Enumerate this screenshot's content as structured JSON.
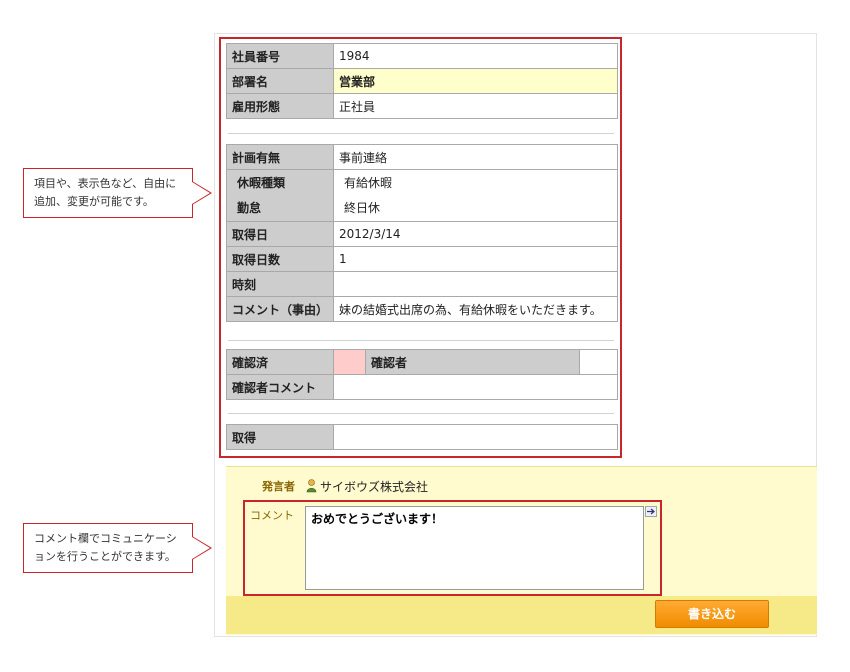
{
  "form": {
    "employee_no": {
      "label": "社員番号",
      "value": "1984"
    },
    "department": {
      "label": "部署名",
      "value": "営業部"
    },
    "employment_type": {
      "label": "雇用形態",
      "value": "正社員"
    },
    "plan": {
      "label": "計画有無",
      "value": "事前連絡"
    },
    "leave_type": {
      "label": "休暇種類",
      "value": "有給休暇"
    },
    "attendance": {
      "label": "勤怠",
      "value": "終日休"
    },
    "date": {
      "label": "取得日",
      "value": "2012/3/14"
    },
    "days": {
      "label": "取得日数",
      "value": "1"
    },
    "time": {
      "label": "時刻",
      "value": ""
    },
    "comment_reason": {
      "label": "コメント（事由）",
      "value": "妹の結婚式出席の為、有給休暇をいただきます。"
    },
    "confirmed": {
      "label": "確認済",
      "value": ""
    },
    "confirmer": {
      "label": "確認者",
      "value": ""
    },
    "confirmer_comment": {
      "label": "確認者コメント",
      "value": ""
    },
    "acquired": {
      "label": "取得",
      "value": ""
    }
  },
  "callouts": {
    "items_note": "項目や、表示色など、自由に追加、変更が可能です。",
    "comment_note": "コメント欄でコミュニケーションを行うことができます。"
  },
  "comment": {
    "speaker_label": "発言者",
    "speaker_name": "サイボウズ株式会社",
    "comment_label": "コメント",
    "comment_value": "おめでとうございます！",
    "submit_label": "書き込む"
  },
  "colors": {
    "accent_red": "#c8262b",
    "label_gray": "#cdcdcd",
    "highlight_yellow": "#ffffcc",
    "confirmed_pink": "#ffcccc",
    "button_orange": "#f5960f"
  }
}
